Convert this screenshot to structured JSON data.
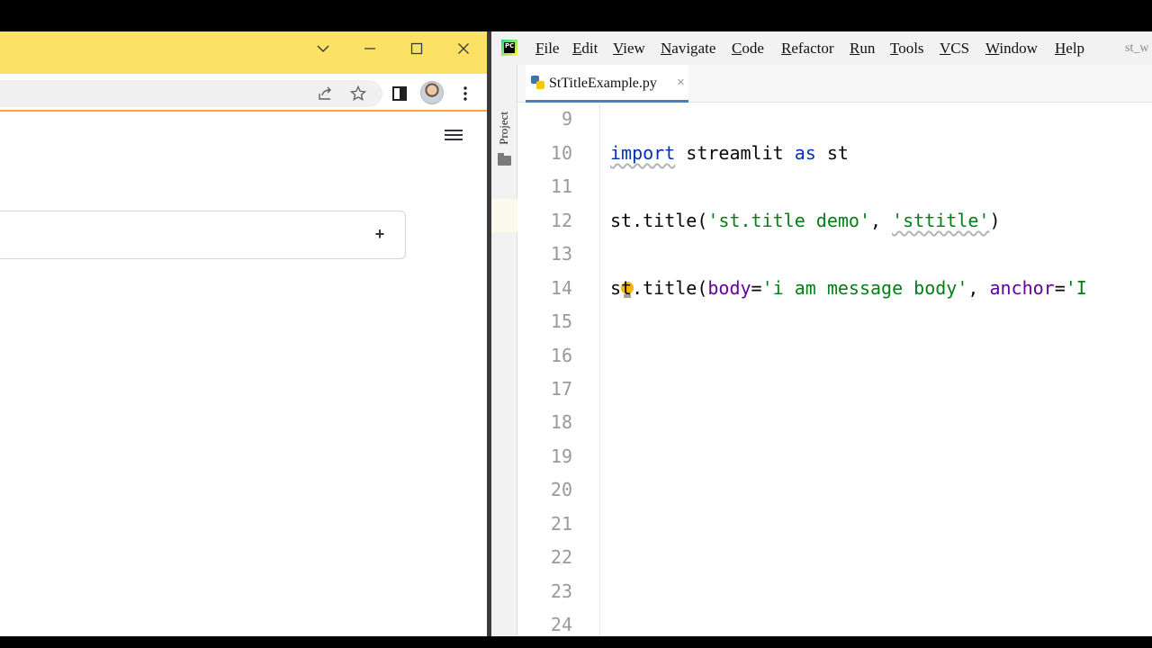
{
  "browser": {
    "window_controls": [
      "chevron-down",
      "minimize",
      "maximize",
      "close"
    ],
    "toolbar_icons": [
      "share-icon",
      "star-icon",
      "sidebar-icon",
      "avatar",
      "more-icon"
    ],
    "menu_icon": "hamburger-icon",
    "input_plus": "+",
    "accent": "#f2a73b",
    "titlebar_color": "#fbe264"
  },
  "ide": {
    "menu": [
      "File",
      "Edit",
      "View",
      "Navigate",
      "Code",
      "Refactor",
      "Run",
      "Tools",
      "VCS",
      "Window",
      "Help"
    ],
    "menu_tail": "st_w",
    "tool_window_label": "Project",
    "tab": {
      "name": "StTitleExample.py",
      "close": "×"
    },
    "current_line": "14",
    "lines": [
      {
        "n": "9",
        "code": ""
      },
      {
        "n": "10",
        "code": "import streamlit as st"
      },
      {
        "n": "11",
        "code": ""
      },
      {
        "n": "12",
        "code": "st.title('st.title demo', 'sttitle')"
      },
      {
        "n": "13",
        "code": ""
      },
      {
        "n": "14",
        "code": "st.title(body='i am message body', anchor='I"
      },
      {
        "n": "15",
        "code": ""
      },
      {
        "n": "16",
        "code": ""
      },
      {
        "n": "17",
        "code": ""
      },
      {
        "n": "18",
        "code": ""
      },
      {
        "n": "19",
        "code": ""
      },
      {
        "n": "20",
        "code": ""
      },
      {
        "n": "21",
        "code": ""
      },
      {
        "n": "22",
        "code": ""
      },
      {
        "n": "23",
        "code": ""
      },
      {
        "n": "24",
        "code": ""
      }
    ],
    "colors": {
      "keyword": "#0033b3",
      "string": "#067d17",
      "param": "#660099",
      "tab_accent": "#4083c9"
    }
  }
}
